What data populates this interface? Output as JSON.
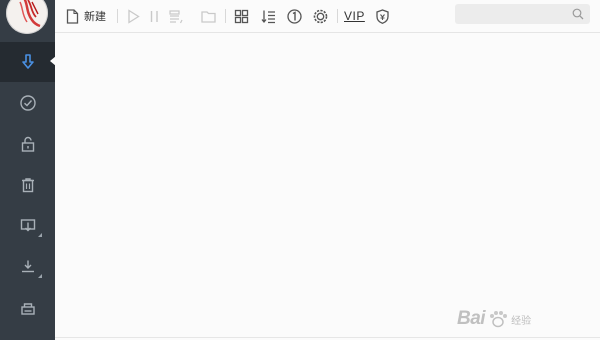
{
  "app": {
    "new_label": "新建",
    "vip_label": "VIP",
    "accent": "#4a90e2"
  },
  "sidebar": {
    "items": [
      {
        "name": "download",
        "icon": "download-icon",
        "active": true
      },
      {
        "name": "completed",
        "icon": "check-circle-icon",
        "active": false
      },
      {
        "name": "private",
        "icon": "lock-icon",
        "active": false
      },
      {
        "name": "trash",
        "icon": "trash-icon",
        "active": false
      },
      {
        "name": "desktop-download",
        "icon": "monitor-download-icon",
        "active": false
      },
      {
        "name": "download-tray",
        "icon": "download-tray-icon",
        "active": false
      },
      {
        "name": "printer",
        "icon": "printer-icon",
        "active": false
      }
    ]
  },
  "toolbar": {
    "search": {
      "placeholder": ""
    }
  },
  "watermark": {
    "brand": "Bai",
    "cn": "经验"
  }
}
